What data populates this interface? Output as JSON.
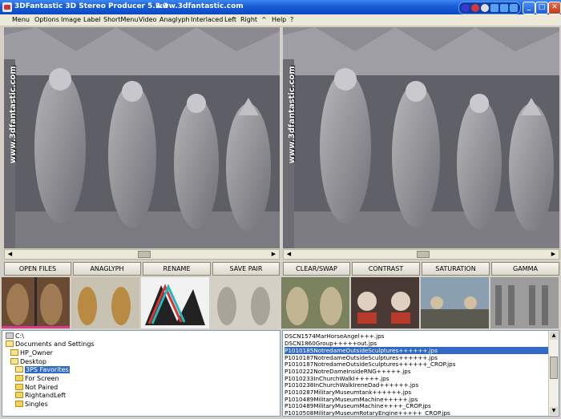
{
  "window": {
    "title": "3DFantastic  3D Stereo Producer 5.3.3",
    "url": "www.3dfantastic.com",
    "controls": {
      "minimize": "_",
      "maximize": "□",
      "close": "✕"
    },
    "colors": {
      "titlebar": "#0a48c4",
      "selection": "#316ac5",
      "accent": "#d93a8c"
    }
  },
  "menu": [
    "Menu",
    "Options",
    "Image",
    "Label",
    "ShortMenu",
    "Video",
    "Anaglyph",
    "Interlaced",
    "Left",
    "Right",
    "^",
    "Help",
    "?"
  ],
  "viewer": {
    "watermark_left": "www.3dfantastic.com",
    "watermark_right": "www.3dfantastic.com"
  },
  "buttons": [
    "OPEN FILES",
    "ANAGLYPH",
    "RENAME",
    "SAVE PAIR",
    "CLEAR/SWAP",
    "CONTRAST",
    "SATURATION",
    "GAMMA"
  ],
  "thumbnails": [
    {
      "name": "thumb-statues-sepia",
      "selected": true
    },
    {
      "name": "thumb-statues-gold",
      "selected": false
    },
    {
      "name": "thumb-anaglyph",
      "selected": false
    },
    {
      "name": "thumb-statues-pale",
      "selected": false
    },
    {
      "name": "thumb-sculpture-group",
      "selected": false
    },
    {
      "name": "thumb-church-interior",
      "selected": false
    },
    {
      "name": "thumb-street-scene",
      "selected": false
    },
    {
      "name": "thumb-gothic-facade",
      "selected": false
    }
  ],
  "folders": [
    {
      "label": "C:\\",
      "level": 0,
      "type": "drive",
      "selected": false
    },
    {
      "label": "Documents and Settings",
      "level": 0,
      "type": "open",
      "selected": false
    },
    {
      "label": "HP_Owner",
      "level": 1,
      "type": "open",
      "selected": false
    },
    {
      "label": "Desktop",
      "level": 1,
      "type": "open",
      "selected": false
    },
    {
      "label": "3PS Favorites",
      "level": 2,
      "type": "open",
      "selected": true
    },
    {
      "label": "For Screen",
      "level": 3,
      "type": "closed",
      "selected": false
    },
    {
      "label": "Not Paired",
      "level": 3,
      "type": "closed",
      "selected": false
    },
    {
      "label": "RightandLeft",
      "level": 3,
      "type": "closed",
      "selected": false
    },
    {
      "label": "Singles",
      "level": 3,
      "type": "closed",
      "selected": false
    }
  ],
  "files": [
    {
      "name": "DSCN1574MarHorseAngel+++.jps",
      "selected": false
    },
    {
      "name": "DSCN1860Group+++++out.jps",
      "selected": false
    },
    {
      "name": "P1010185NotredameOutsideSculptures++++++.jps",
      "selected": true
    },
    {
      "name": "P1010187NotredameOutsideSculptures++++++.jps",
      "selected": false
    },
    {
      "name": "P1010187NotredameOutsideSculptures++++++_CROP.jps",
      "selected": false
    },
    {
      "name": "P1010222NotreDameInsideRNG+++++.jps",
      "selected": false
    },
    {
      "name": "P1010233InChurchWalkI+++++.jps",
      "selected": false
    },
    {
      "name": "P1010238InChurchWalkIreneDad++++++.jps",
      "selected": false
    },
    {
      "name": "P1010287MilitaryMuseumtank++++++.jps",
      "selected": false
    },
    {
      "name": "P1010489MilitaryMuseumMachine+++++.jps",
      "selected": false
    },
    {
      "name": "P1010489MilitaryMuseumMachine++++_CROP.jps",
      "selected": false
    },
    {
      "name": "P1010508MilitaryMuseumRotaryEngine+++++_CROP.jps",
      "selected": false
    }
  ]
}
